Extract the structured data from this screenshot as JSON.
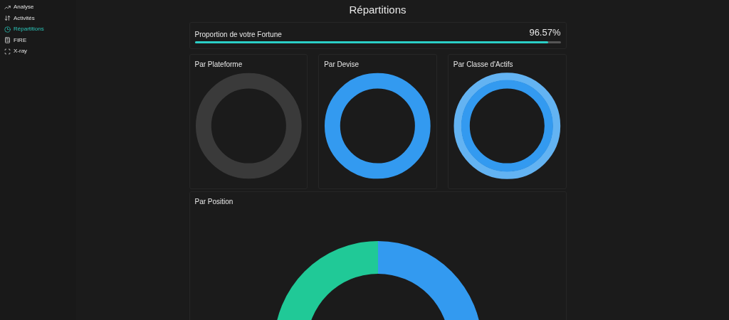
{
  "sidebar": {
    "items": [
      {
        "label": "Analyse",
        "selected": false
      },
      {
        "label": "Activités",
        "selected": false
      },
      {
        "label": "Répartitions",
        "selected": true
      },
      {
        "label": "FIRE",
        "selected": false
      },
      {
        "label": "X-ray",
        "selected": false
      }
    ]
  },
  "page": {
    "title": "Répartitions"
  },
  "fortune": {
    "label": "Proportion de votre Fortune",
    "reading": "96.57%",
    "level": 0.9657
  },
  "cards": [
    {
      "title": "Par Plateforme",
      "kind": "grey"
    },
    {
      "title": "Par Devise",
      "kind": "blue"
    },
    {
      "title": "Par Classe d'Actifs",
      "kind": "double"
    }
  ],
  "position": {
    "title": "Par Position"
  }
}
